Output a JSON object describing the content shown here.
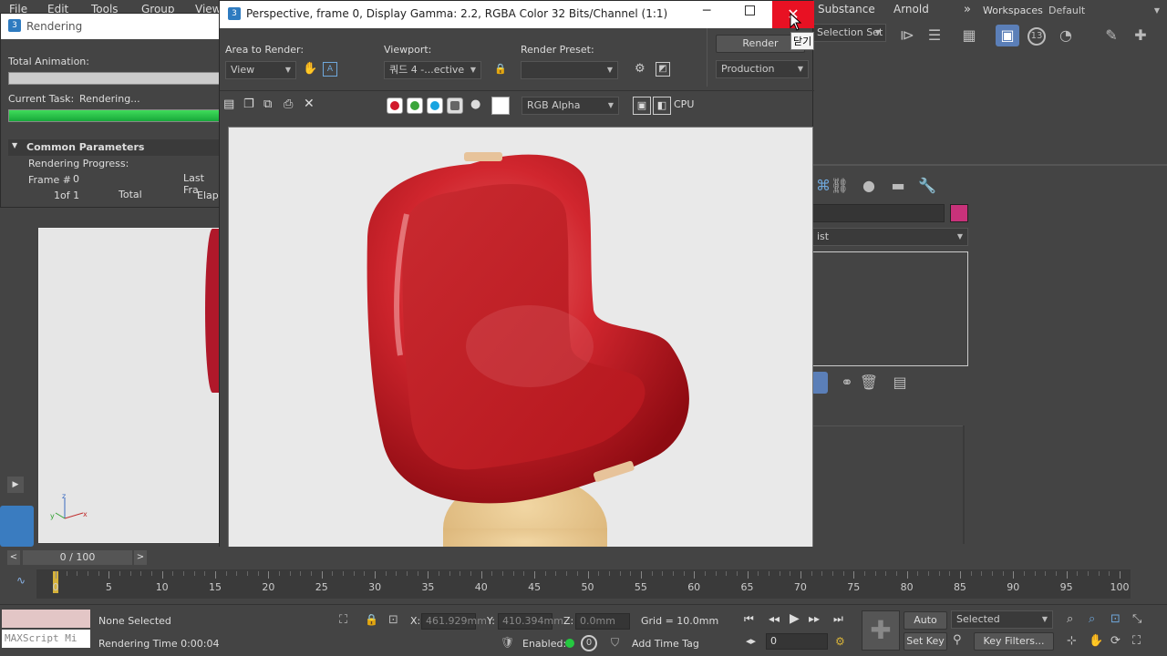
{
  "main_menu": [
    "File",
    "Edit",
    "Tools",
    "Group",
    "View",
    "Substance",
    "Arnold"
  ],
  "workspaces_label": "Workspaces:",
  "workspace_value": "Default",
  "selection_set": "Selection Set",
  "toolbar_badge": "13",
  "cmd_list_label": "ist",
  "rendering": {
    "title": "Rendering",
    "total_animation": "Total Animation:",
    "current_task": "Current Task:",
    "current_task_value": "Rendering...",
    "progress": 1.0,
    "rollout": "Common Parameters",
    "rendering_progress": "Rendering Progress:",
    "frame_label": "Frame #",
    "frame_value": "0",
    "last_frame": "Last Fra",
    "of": "1of 1",
    "total": "Total",
    "elapsed": "Elaps"
  },
  "frame_window": {
    "title": "Perspective, frame 0, Display Gamma: 2.2, RGBA Color 32 Bits/Channel (1:1)",
    "area_label": "Area to Render:",
    "area_value": "View",
    "viewport_label": "Viewport:",
    "viewport_value": "쿼드 4 -...ective",
    "preset_label": "Render Preset:",
    "preset_value": "",
    "render_button": "Render",
    "production": "Production",
    "channel_select": "RGB Alpha",
    "cpu_label": "CPU",
    "close_tooltip": "닫기",
    "colors": {
      "red": "#d11a2a",
      "green": "#3aa53a",
      "blue": "#19a4e0"
    }
  },
  "timeline": {
    "slider": "0 / 100",
    "ticks": [
      0,
      5,
      10,
      15,
      20,
      25,
      30,
      35,
      40,
      45,
      50,
      55,
      60,
      65,
      70,
      75,
      80,
      85,
      90,
      95,
      100
    ]
  },
  "status": {
    "maxscript": "MAXScript Mi",
    "none_selected": "None Selected",
    "rendering_time": "Rendering Time  0:00:04",
    "x_label": "X:",
    "x_value": "461.929mm",
    "y_label": "Y:",
    "y_value": "410.394mm",
    "z_label": "Z:",
    "z_value": "0.0mm",
    "grid": "Grid = 10.0mm",
    "enabled": "Enabled:",
    "add_time_tag": "Add Time Tag",
    "auto_key": "Auto Key",
    "selected": "Selected",
    "set_key": "Set Key",
    "key_filters": "Key Filters...",
    "frame_field": "0"
  }
}
